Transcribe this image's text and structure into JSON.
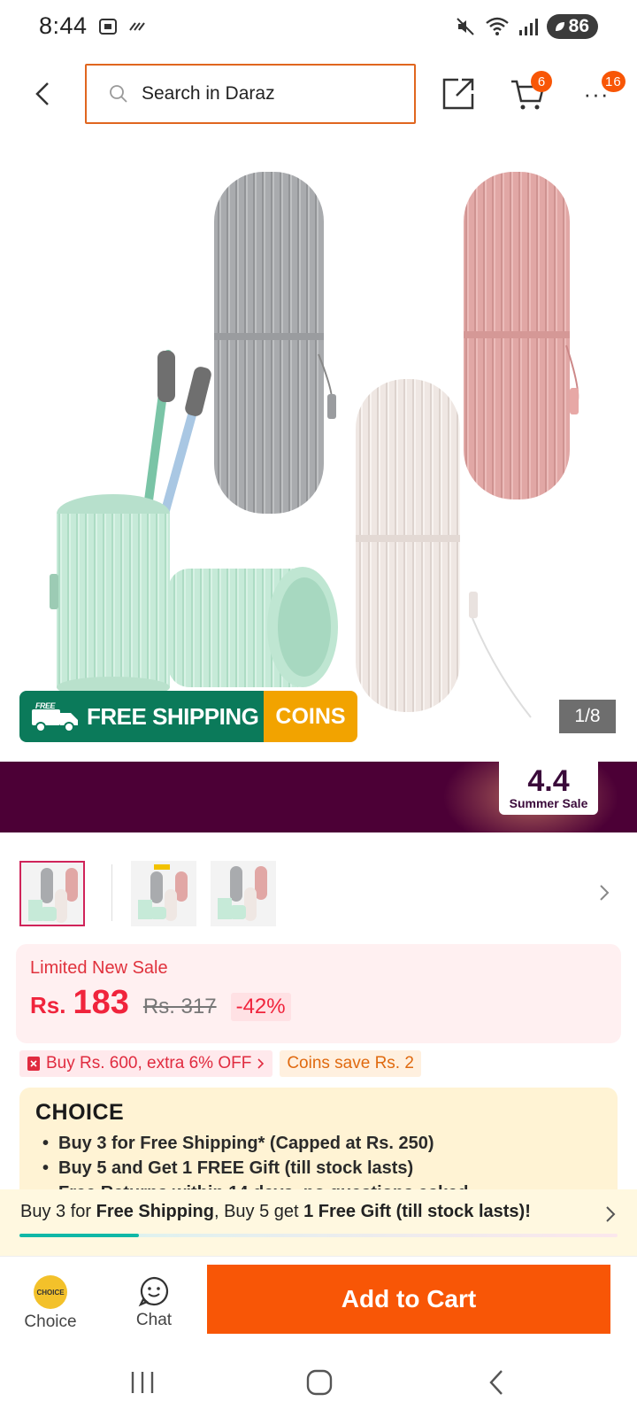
{
  "status_bar": {
    "time": "8:44",
    "battery": "86"
  },
  "header": {
    "search_placeholder": "Search in Daraz",
    "cart_badge": "6",
    "more_badge": "16"
  },
  "gallery": {
    "banner_free_label": "FREE",
    "banner_shipping": "FREE SHIPPING",
    "banner_coins": "COINS",
    "page_indicator": "1/8",
    "sale_number": "4.4",
    "sale_text": "Summer Sale",
    "thumbnail_count": 3,
    "active_thumbnail": 1
  },
  "price": {
    "label": "Limited New Sale",
    "currency": "Rs.",
    "current": "183",
    "original": "Rs. 317",
    "discount": "-42%"
  },
  "promos": {
    "voucher": "Buy Rs. 600, extra 6% OFF",
    "coins": "Coins save Rs. 2"
  },
  "choice": {
    "logo": "CHOICE",
    "benefits": [
      "Buy 3 for  Free Shipping* (Capped at Rs. 250)",
      "Buy 5 and Get 1 FREE Gift (till stock lasts)",
      "Free Returns within 14 days, no questions asked"
    ],
    "bar_text_1": "Buy 3 for ",
    "bar_bold_1": "Free Shipping",
    "bar_text_2": ", Buy 5 get ",
    "bar_bold_2": "1 Free Gift (till stock lasts)!",
    "progress": 0.2
  },
  "action_bar": {
    "choice_label": "Choice",
    "choice_coin_text": "CHOICE",
    "chat_label": "Chat",
    "add_to_cart": "Add to Cart"
  },
  "colors": {
    "accent": "#f85606",
    "price": "#f0243c",
    "sale_strip": "#4c0036",
    "free_shipping": "#0b7a5a",
    "coins": "#f2a300"
  }
}
